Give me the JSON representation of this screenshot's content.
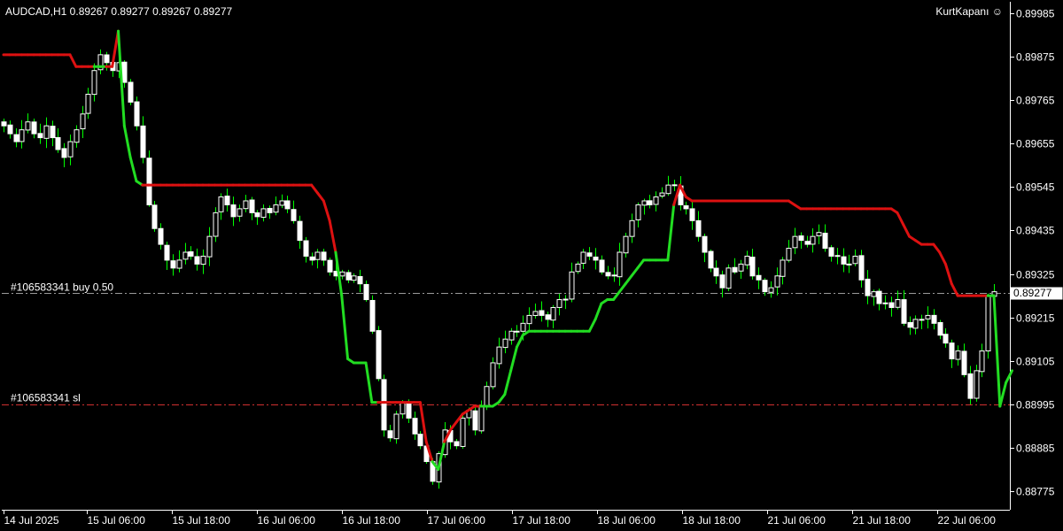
{
  "header": {
    "symbol_info": "AUDCAD,H1  0.89267 0.89277 0.89267 0.89277",
    "indicator_name": "KurtKapanı ☺"
  },
  "colors": {
    "background": "#000000",
    "candle": "#ffffff",
    "wick": "#00ff00",
    "trail_up": "#22dd22",
    "trail_down": "#dd1111",
    "order_line": "#9a9a9a",
    "sl_line": "#d03030",
    "axis": "#ffffff"
  },
  "chart_data": {
    "type": "candlestick",
    "symbol": "AUDCAD",
    "timeframe": "H1",
    "ylim": [
      0.8871,
      0.9001
    ],
    "yticks": [
      "0.89985",
      "0.89875",
      "0.89765",
      "0.89655",
      "0.89545",
      "0.89435",
      "0.89325",
      "0.89215",
      "0.89105",
      "0.88995",
      "0.88885",
      "0.88775"
    ],
    "xticks": [
      "14 Jul 2025",
      "15 Jul 06:00",
      "15 Jul 18:00",
      "16 Jul 06:00",
      "16 Jul 18:00",
      "17 Jul 06:00",
      "17 Jul 18:00",
      "18 Jul 06:00",
      "18 Jul 18:00",
      "21 Jul 06:00",
      "21 Jul 18:00",
      "22 Jul 06:00"
    ],
    "current_price": "0.89277",
    "order_lines": [
      {
        "label": "#106583341 buy 0.50",
        "price": 0.89277,
        "style": "dash-dot",
        "color": "#9a9a9a"
      },
      {
        "label": "#106583341 sl",
        "price": 0.88995,
        "style": "dash-dot",
        "color": "#d03030"
      }
    ],
    "close": [
      0.897,
      0.8968,
      0.8966,
      0.8969,
      0.8971,
      0.8968,
      0.8967,
      0.897,
      0.8967,
      0.8964,
      0.8962,
      0.8966,
      0.8969,
      0.8973,
      0.8978,
      0.8984,
      0.8988,
      0.8986,
      0.8984,
      0.8986,
      0.8981,
      0.8976,
      0.897,
      0.8962,
      0.895,
      0.8944,
      0.894,
      0.8936,
      0.8934,
      0.8936,
      0.8938,
      0.8937,
      0.8935,
      0.8937,
      0.8942,
      0.8948,
      0.8952,
      0.895,
      0.8947,
      0.8949,
      0.8951,
      0.8948,
      0.8947,
      0.8949,
      0.8948,
      0.895,
      0.8951,
      0.8949,
      0.8946,
      0.8941,
      0.8937,
      0.8936,
      0.8938,
      0.8936,
      0.8933,
      0.8932,
      0.8933,
      0.8931,
      0.8932,
      0.893,
      0.8926,
      0.8918,
      0.8906,
      0.8893,
      0.8891,
      0.8897,
      0.89,
      0.8896,
      0.8892,
      0.8889,
      0.8885,
      0.888,
      0.8887,
      0.8893,
      0.889,
      0.8889,
      0.8896,
      0.8898,
      0.8893,
      0.8899,
      0.8904,
      0.891,
      0.8914,
      0.8916,
      0.8918,
      0.8918,
      0.892,
      0.8922,
      0.8923,
      0.8922,
      0.8921,
      0.8924,
      0.8926,
      0.8926,
      0.8933,
      0.8935,
      0.8938,
      0.8937,
      0.8936,
      0.8933,
      0.8932,
      0.8932,
      0.8938,
      0.8942,
      0.8946,
      0.895,
      0.8951,
      0.895,
      0.8952,
      0.8953,
      0.8955,
      0.8955,
      0.895,
      0.8949,
      0.8946,
      0.8942,
      0.8938,
      0.8934,
      0.8932,
      0.8929,
      0.8934,
      0.8933,
      0.8935,
      0.8937,
      0.8932,
      0.8931,
      0.8928,
      0.8929,
      0.8932,
      0.8936,
      0.8939,
      0.8942,
      0.8941,
      0.894,
      0.8942,
      0.8943,
      0.8939,
      0.8937,
      0.8937,
      0.8935,
      0.8935,
      0.8937,
      0.8931,
      0.8927,
      0.8928,
      0.8925,
      0.8925,
      0.8924,
      0.8926,
      0.892,
      0.8919,
      0.8921,
      0.8921,
      0.8922,
      0.892,
      0.8917,
      0.8915,
      0.8911,
      0.8913,
      0.8907,
      0.8901,
      0.8908,
      0.8913,
      0.8927,
      0.8928
    ],
    "trailing_stop": [
      0.8988,
      0.8988,
      0.8988,
      0.8988,
      0.8988,
      0.8988,
      0.8988,
      0.8988,
      0.8988,
      0.8988,
      0.8988,
      0.8988,
      0.8985,
      0.8985,
      0.8985,
      0.8985,
      0.8985,
      0.8985,
      0.8985,
      0.8994,
      0.897,
      0.8962,
      0.8956,
      0.8955,
      0.8955,
      0.8955,
      0.8955,
      0.8955,
      0.8955,
      0.8955,
      0.8955,
      0.8955,
      0.8955,
      0.8955,
      0.8955,
      0.8955,
      0.8955,
      0.8955,
      0.8955,
      0.8955,
      0.8955,
      0.8955,
      0.8955,
      0.8955,
      0.8955,
      0.8955,
      0.8955,
      0.8955,
      0.8955,
      0.8955,
      0.8955,
      0.8955,
      0.8953,
      0.8951,
      0.8946,
      0.8938,
      0.8927,
      0.8911,
      0.891,
      0.891,
      0.891,
      0.89,
      0.89,
      0.89,
      0.89,
      0.89,
      0.89,
      0.89,
      0.89,
      0.89,
      0.889,
      0.8885,
      0.8883,
      0.889,
      0.8893,
      0.8895,
      0.8897,
      0.8898,
      0.8899,
      0.8899,
      0.8899,
      0.8899,
      0.89,
      0.8902,
      0.8908,
      0.8914,
      0.8917,
      0.8918,
      0.8918,
      0.8918,
      0.8918,
      0.8918,
      0.8918,
      0.8918,
      0.8918,
      0.8918,
      0.8918,
      0.8918,
      0.8921,
      0.8925,
      0.8926,
      0.8926,
      0.8928,
      0.893,
      0.8932,
      0.8934,
      0.8936,
      0.8936,
      0.8936,
      0.8936,
      0.8936,
      0.895,
      0.8955,
      0.8952,
      0.8951,
      0.8951,
      0.8951,
      0.8951,
      0.8951,
      0.8951,
      0.8951,
      0.8951,
      0.8951,
      0.8951,
      0.8951,
      0.8951,
      0.8951,
      0.8951,
      0.8951,
      0.8951,
      0.8951,
      0.895,
      0.8949,
      0.8949,
      0.8949,
      0.8949,
      0.8949,
      0.8949,
      0.8949,
      0.8949,
      0.8949,
      0.8949,
      0.8949,
      0.8949,
      0.8949,
      0.8949,
      0.8949,
      0.8949,
      0.8948,
      0.8945,
      0.8942,
      0.8941,
      0.894,
      0.894,
      0.894,
      0.8938,
      0.8935,
      0.893,
      0.8927,
      0.8927,
      0.8927,
      0.8927,
      0.8927,
      0.8927,
      0.8927,
      0.8899,
      0.8905,
      0.8908
    ]
  }
}
